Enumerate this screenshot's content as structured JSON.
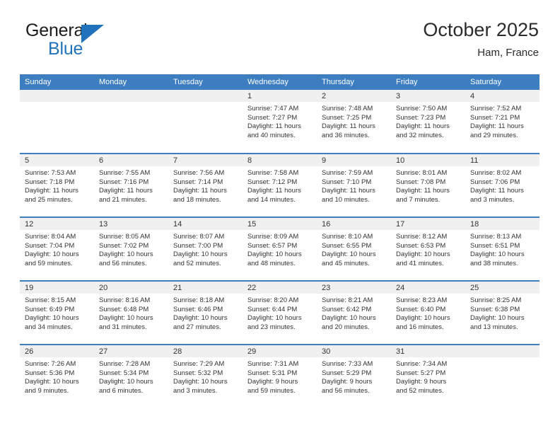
{
  "brand": {
    "name_top": "General",
    "name_bottom": "Blue",
    "flag_icon": "blue-triangle-flag",
    "color_primary": "#1f72bb",
    "color_text": "#1b1b1b"
  },
  "header": {
    "title": "October 2025",
    "subtitle": "Ham, France"
  },
  "theme": {
    "header_blue": "#3c7ebf",
    "daynum_band": "#f0f0f0",
    "text": "#333333"
  },
  "weekday_headers": [
    "Sunday",
    "Monday",
    "Tuesday",
    "Wednesday",
    "Thursday",
    "Friday",
    "Saturday"
  ],
  "weeks": [
    [
      {
        "day": "",
        "blank": true,
        "sunrise": "",
        "sunset": "",
        "daylight_line1": "",
        "daylight_line2": ""
      },
      {
        "day": "",
        "blank": true,
        "sunrise": "",
        "sunset": "",
        "daylight_line1": "",
        "daylight_line2": ""
      },
      {
        "day": "",
        "blank": true,
        "sunrise": "",
        "sunset": "",
        "daylight_line1": "",
        "daylight_line2": ""
      },
      {
        "day": "1",
        "sunrise": "Sunrise: 7:47 AM",
        "sunset": "Sunset: 7:27 PM",
        "daylight_line1": "Daylight: 11 hours",
        "daylight_line2": "and 40 minutes."
      },
      {
        "day": "2",
        "sunrise": "Sunrise: 7:48 AM",
        "sunset": "Sunset: 7:25 PM",
        "daylight_line1": "Daylight: 11 hours",
        "daylight_line2": "and 36 minutes."
      },
      {
        "day": "3",
        "sunrise": "Sunrise: 7:50 AM",
        "sunset": "Sunset: 7:23 PM",
        "daylight_line1": "Daylight: 11 hours",
        "daylight_line2": "and 32 minutes."
      },
      {
        "day": "4",
        "sunrise": "Sunrise: 7:52 AM",
        "sunset": "Sunset: 7:21 PM",
        "daylight_line1": "Daylight: 11 hours",
        "daylight_line2": "and 29 minutes."
      }
    ],
    [
      {
        "day": "5",
        "sunrise": "Sunrise: 7:53 AM",
        "sunset": "Sunset: 7:18 PM",
        "daylight_line1": "Daylight: 11 hours",
        "daylight_line2": "and 25 minutes."
      },
      {
        "day": "6",
        "sunrise": "Sunrise: 7:55 AM",
        "sunset": "Sunset: 7:16 PM",
        "daylight_line1": "Daylight: 11 hours",
        "daylight_line2": "and 21 minutes."
      },
      {
        "day": "7",
        "sunrise": "Sunrise: 7:56 AM",
        "sunset": "Sunset: 7:14 PM",
        "daylight_line1": "Daylight: 11 hours",
        "daylight_line2": "and 18 minutes."
      },
      {
        "day": "8",
        "sunrise": "Sunrise: 7:58 AM",
        "sunset": "Sunset: 7:12 PM",
        "daylight_line1": "Daylight: 11 hours",
        "daylight_line2": "and 14 minutes."
      },
      {
        "day": "9",
        "sunrise": "Sunrise: 7:59 AM",
        "sunset": "Sunset: 7:10 PM",
        "daylight_line1": "Daylight: 11 hours",
        "daylight_line2": "and 10 minutes."
      },
      {
        "day": "10",
        "sunrise": "Sunrise: 8:01 AM",
        "sunset": "Sunset: 7:08 PM",
        "daylight_line1": "Daylight: 11 hours",
        "daylight_line2": "and 7 minutes."
      },
      {
        "day": "11",
        "sunrise": "Sunrise: 8:02 AM",
        "sunset": "Sunset: 7:06 PM",
        "daylight_line1": "Daylight: 11 hours",
        "daylight_line2": "and 3 minutes."
      }
    ],
    [
      {
        "day": "12",
        "sunrise": "Sunrise: 8:04 AM",
        "sunset": "Sunset: 7:04 PM",
        "daylight_line1": "Daylight: 10 hours",
        "daylight_line2": "and 59 minutes."
      },
      {
        "day": "13",
        "sunrise": "Sunrise: 8:05 AM",
        "sunset": "Sunset: 7:02 PM",
        "daylight_line1": "Daylight: 10 hours",
        "daylight_line2": "and 56 minutes."
      },
      {
        "day": "14",
        "sunrise": "Sunrise: 8:07 AM",
        "sunset": "Sunset: 7:00 PM",
        "daylight_line1": "Daylight: 10 hours",
        "daylight_line2": "and 52 minutes."
      },
      {
        "day": "15",
        "sunrise": "Sunrise: 8:09 AM",
        "sunset": "Sunset: 6:57 PM",
        "daylight_line1": "Daylight: 10 hours",
        "daylight_line2": "and 48 minutes."
      },
      {
        "day": "16",
        "sunrise": "Sunrise: 8:10 AM",
        "sunset": "Sunset: 6:55 PM",
        "daylight_line1": "Daylight: 10 hours",
        "daylight_line2": "and 45 minutes."
      },
      {
        "day": "17",
        "sunrise": "Sunrise: 8:12 AM",
        "sunset": "Sunset: 6:53 PM",
        "daylight_line1": "Daylight: 10 hours",
        "daylight_line2": "and 41 minutes."
      },
      {
        "day": "18",
        "sunrise": "Sunrise: 8:13 AM",
        "sunset": "Sunset: 6:51 PM",
        "daylight_line1": "Daylight: 10 hours",
        "daylight_line2": "and 38 minutes."
      }
    ],
    [
      {
        "day": "19",
        "sunrise": "Sunrise: 8:15 AM",
        "sunset": "Sunset: 6:49 PM",
        "daylight_line1": "Daylight: 10 hours",
        "daylight_line2": "and 34 minutes."
      },
      {
        "day": "20",
        "sunrise": "Sunrise: 8:16 AM",
        "sunset": "Sunset: 6:48 PM",
        "daylight_line1": "Daylight: 10 hours",
        "daylight_line2": "and 31 minutes."
      },
      {
        "day": "21",
        "sunrise": "Sunrise: 8:18 AM",
        "sunset": "Sunset: 6:46 PM",
        "daylight_line1": "Daylight: 10 hours",
        "daylight_line2": "and 27 minutes."
      },
      {
        "day": "22",
        "sunrise": "Sunrise: 8:20 AM",
        "sunset": "Sunset: 6:44 PM",
        "daylight_line1": "Daylight: 10 hours",
        "daylight_line2": "and 23 minutes."
      },
      {
        "day": "23",
        "sunrise": "Sunrise: 8:21 AM",
        "sunset": "Sunset: 6:42 PM",
        "daylight_line1": "Daylight: 10 hours",
        "daylight_line2": "and 20 minutes."
      },
      {
        "day": "24",
        "sunrise": "Sunrise: 8:23 AM",
        "sunset": "Sunset: 6:40 PM",
        "daylight_line1": "Daylight: 10 hours",
        "daylight_line2": "and 16 minutes."
      },
      {
        "day": "25",
        "sunrise": "Sunrise: 8:25 AM",
        "sunset": "Sunset: 6:38 PM",
        "daylight_line1": "Daylight: 10 hours",
        "daylight_line2": "and 13 minutes."
      }
    ],
    [
      {
        "day": "26",
        "sunrise": "Sunrise: 7:26 AM",
        "sunset": "Sunset: 5:36 PM",
        "daylight_line1": "Daylight: 10 hours",
        "daylight_line2": "and 9 minutes."
      },
      {
        "day": "27",
        "sunrise": "Sunrise: 7:28 AM",
        "sunset": "Sunset: 5:34 PM",
        "daylight_line1": "Daylight: 10 hours",
        "daylight_line2": "and 6 minutes."
      },
      {
        "day": "28",
        "sunrise": "Sunrise: 7:29 AM",
        "sunset": "Sunset: 5:32 PM",
        "daylight_line1": "Daylight: 10 hours",
        "daylight_line2": "and 3 minutes."
      },
      {
        "day": "29",
        "sunrise": "Sunrise: 7:31 AM",
        "sunset": "Sunset: 5:31 PM",
        "daylight_line1": "Daylight: 9 hours",
        "daylight_line2": "and 59 minutes."
      },
      {
        "day": "30",
        "sunrise": "Sunrise: 7:33 AM",
        "sunset": "Sunset: 5:29 PM",
        "daylight_line1": "Daylight: 9 hours",
        "daylight_line2": "and 56 minutes."
      },
      {
        "day": "31",
        "sunrise": "Sunrise: 7:34 AM",
        "sunset": "Sunset: 5:27 PM",
        "daylight_line1": "Daylight: 9 hours",
        "daylight_line2": "and 52 minutes."
      },
      {
        "day": "",
        "blank": true,
        "sunrise": "",
        "sunset": "",
        "daylight_line1": "",
        "daylight_line2": ""
      }
    ]
  ]
}
